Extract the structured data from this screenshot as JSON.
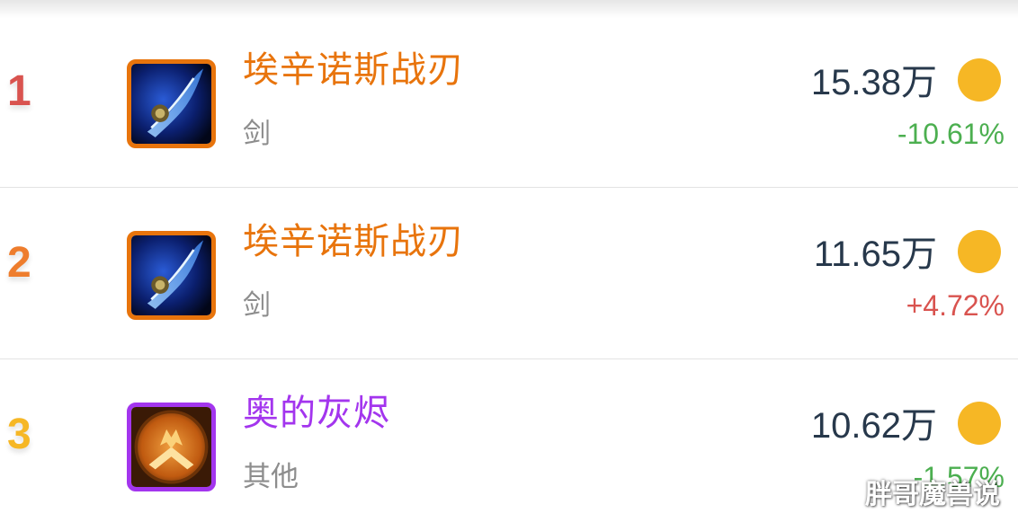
{
  "items": [
    {
      "rank": "1",
      "rank_color": "#d9534f",
      "name": "埃辛诺斯战刃",
      "name_color": "#e8740c",
      "category": "剑",
      "price": "15.38万",
      "change": "-10.61%",
      "change_color": "#4caf50",
      "icon": "blade-icon",
      "icon_border": "#e8740c"
    },
    {
      "rank": "2",
      "rank_color": "#ee7d2d",
      "name": "埃辛诺斯战刃",
      "name_color": "#e8740c",
      "category": "剑",
      "price": "11.65万",
      "change": "+4.72%",
      "change_color": "#d9534f",
      "icon": "blade-icon",
      "icon_border": "#e8740c"
    },
    {
      "rank": "3",
      "rank_color": "#f6b725",
      "name": "奥的灰烬",
      "name_color": "#a335ee",
      "category": "其他",
      "price": "10.62万",
      "change": "-1.57%",
      "change_color": "#4caf50",
      "icon": "ashes-icon",
      "icon_border": "#a335ee"
    }
  ],
  "coin_color": "#f6b725",
  "watermark": "胖哥魔兽说"
}
